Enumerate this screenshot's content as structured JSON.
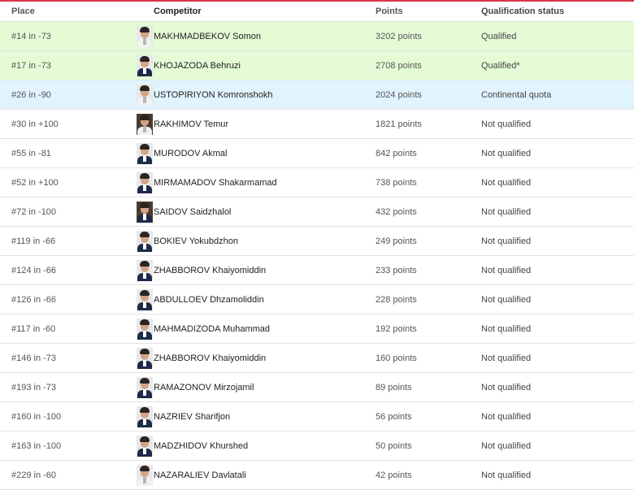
{
  "headers": {
    "place": "Place",
    "competitor": "Competitor",
    "points": "Points",
    "status": "Qualification status"
  },
  "colors": {
    "accent": "#d9344d",
    "qualified_bg": "#e4fbd6",
    "continental_bg": "#e1f3fc"
  },
  "rows": [
    {
      "place": "#14 in -73",
      "name": "MAKHMADBEKOV Somon",
      "points": "3202 points",
      "status": "Qualified",
      "photo": "judogi"
    },
    {
      "place": "#17 in -73",
      "name": "KHOJAZODA Behruzi",
      "points": "2708 points",
      "status": "Qualified*",
      "photo": "suit"
    },
    {
      "place": "#26 in -90",
      "name": "USTOPIRIYON Komronshokh",
      "points": "2024 points",
      "status": "Continental quota",
      "photo": "judogi"
    },
    {
      "place": "#30 in +100",
      "name": "RAKHIMOV Temur",
      "points": "1821 points",
      "status": "Not qualified",
      "photo": "judogi-dark"
    },
    {
      "place": "#55 in -81",
      "name": "MURODOV Akmal",
      "points": "842 points",
      "status": "Not qualified",
      "photo": "suit"
    },
    {
      "place": "#52 in +100",
      "name": "MIRMAMADOV Shakarmamad",
      "points": "738 points",
      "status": "Not qualified",
      "photo": "suit"
    },
    {
      "place": "#72 in -100",
      "name": "SAIDOV Saidzhalol",
      "points": "432 points",
      "status": "Not qualified",
      "photo": "suit-dark"
    },
    {
      "place": "#119 in -66",
      "name": "BOKIEV Yokubdzhon",
      "points": "249 points",
      "status": "Not qualified",
      "photo": "suit"
    },
    {
      "place": "#124 in -66",
      "name": "ZHABBOROV Khaiyomiddin",
      "points": "233 points",
      "status": "Not qualified",
      "photo": "suit"
    },
    {
      "place": "#126 in -66",
      "name": "ABDULLOEV Dhzamoliddin",
      "points": "228 points",
      "status": "Not qualified",
      "photo": "suit"
    },
    {
      "place": "#117 in -60",
      "name": "MAHMADIZODA Muhammad",
      "points": "192 points",
      "status": "Not qualified",
      "photo": "suit"
    },
    {
      "place": "#146 in -73",
      "name": "ZHABBOROV Khaiyomiddin",
      "points": "160 points",
      "status": "Not qualified",
      "photo": "suit"
    },
    {
      "place": "#193 in -73",
      "name": "RAMAZONOV Mirzojamil",
      "points": "89 points",
      "status": "Not qualified",
      "photo": "suit"
    },
    {
      "place": "#160 in -100",
      "name": "NAZRIEV Sharifjon",
      "points": "56 points",
      "status": "Not qualified",
      "photo": "suit"
    },
    {
      "place": "#163 in -100",
      "name": "MADZHIDOV Khurshed",
      "points": "50 points",
      "status": "Not qualified",
      "photo": "suit"
    },
    {
      "place": "#229 in -60",
      "name": "NAZARALIEV Davlatali",
      "points": "42 points",
      "status": "Not qualified",
      "photo": "judogi"
    }
  ]
}
